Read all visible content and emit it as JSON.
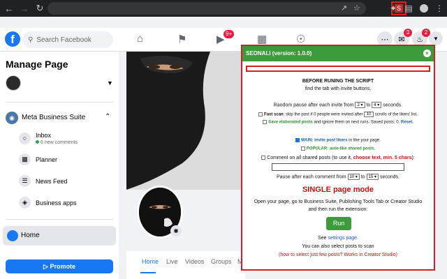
{
  "browser": {
    "colors": {
      "toolbar": "#202124",
      "omnibox": "#35363a",
      "highlight_border": "#e02020"
    }
  },
  "facebook": {
    "search_placeholder": "Search Facebook",
    "nav_badge": "9+",
    "messenger_badge": "3",
    "notif_badge": "2",
    "brand_color": "#1877f2"
  },
  "sidebar": {
    "title": "Manage Page",
    "mbs_label": "Meta Business Suite",
    "items": [
      {
        "label": "Inbox",
        "sub": "6 new comments",
        "icon": "chat-icon"
      },
      {
        "label": "Planner",
        "icon": "calendar-icon"
      },
      {
        "label": "News Feed",
        "icon": "feed-icon"
      },
      {
        "label": "Business apps",
        "icon": "apps-icon"
      }
    ],
    "home_label": "Home",
    "promote_label": "Promote"
  },
  "page_tabs": [
    "Home",
    "Live",
    "Videos",
    "Groups",
    "More"
  ],
  "popup": {
    "title": "SEONALI (version: 1.0.0)",
    "before_1": "BEFORE RUNING THE SCRIPT",
    "before_2": "find the tab with invite buttons,",
    "pause_prefix": "Random pause after each invite from",
    "pause_from": "2",
    "pause_to_word": "to",
    "pause_to": "4",
    "pause_suffix": "seconds.",
    "fast_scan_label": "Fast scan",
    "fast_scan_text": ": skip the post if 0 people were invited after",
    "fast_scan_value": "10",
    "fast_scan_suffix": "scrolls of the likers' list.",
    "save_elab": "Save elaborated posts",
    "save_elab_rest": "and ignore them on next runs. Saved posts: 0.",
    "reset": "Reset.",
    "main_label": "MAIN: invite post likers",
    "main_rest": "to like your page.",
    "popular_label": "POPULAR: auto-like shared posts.",
    "comment_prefix": "Comment on all shared posts (to use it,",
    "comment_red": "choose text, min. 5 chars",
    "comment_suffix": "):",
    "pause_comment_prefix": "Pause after each comment from",
    "pause_comment_from": "10",
    "pause_comment_to_word": "to",
    "pause_comment_to": "15",
    "pause_comment_suffix": "seconds.",
    "mode_title": "SINGLE page mode",
    "instr_1": "Open your page, go to Business Suite, Publishing Tools Tab or Creator Studio",
    "instr_2": "and then run the extension:",
    "run_label": "Run",
    "see_prefix": "See",
    "settings_link": "settings page.",
    "select_posts": "You can also select posts to scan",
    "how_link": "(how to select just few posts? Works in Creator Studio)",
    "colors": {
      "header": "#3c9c3c",
      "border": "#d81e1e",
      "mode_title": "#d01010"
    }
  }
}
